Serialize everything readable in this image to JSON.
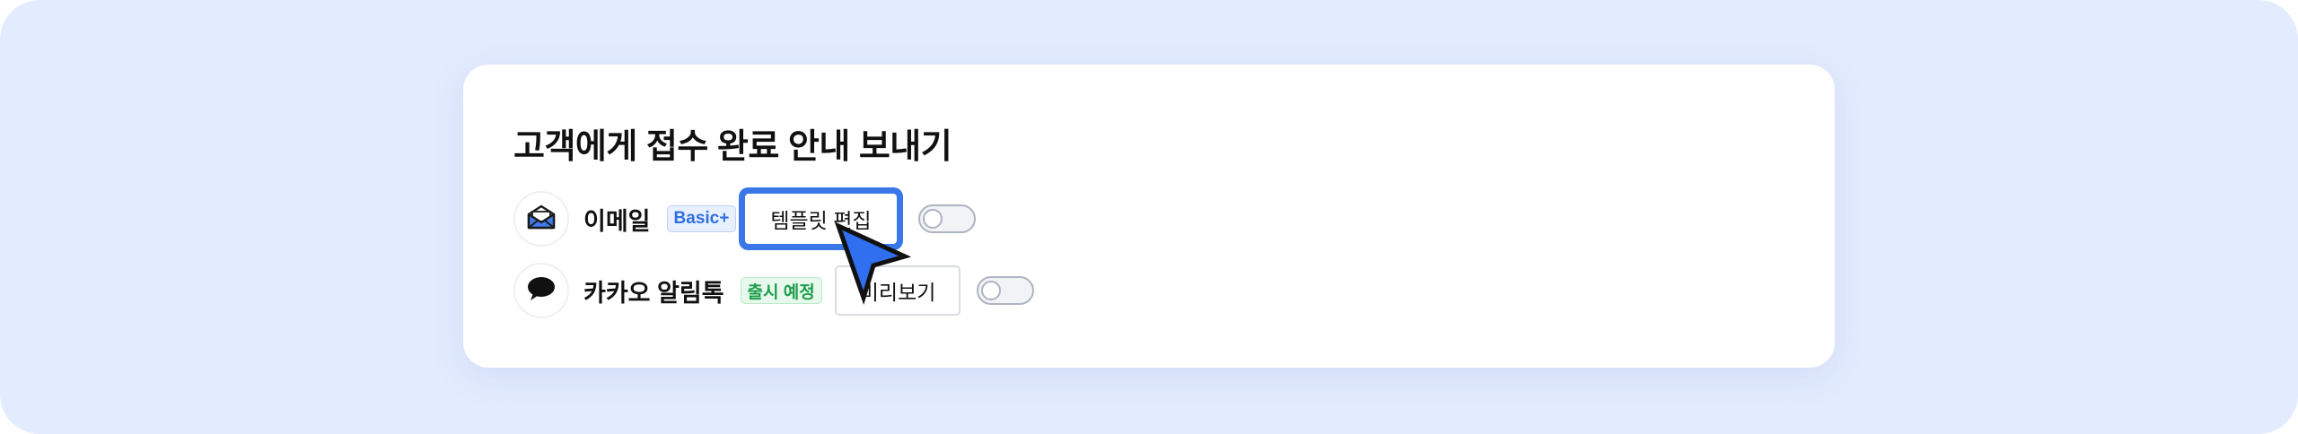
{
  "section": {
    "title": "고객에게 접수 완료 안내 보내기"
  },
  "channels": [
    {
      "icon": "envelope-icon",
      "label": "이메일",
      "badge": "Basic+",
      "action_label": "템플릿 편집",
      "toggle_on": false
    },
    {
      "icon": "speech-bubble-icon",
      "label": "카카오 알림톡",
      "badge": "출시 예정",
      "action_label": "미리보기",
      "toggle_on": false
    }
  ],
  "colors": {
    "background": "#e3ecfe",
    "focus_ring": "#3a78ea",
    "cursor_fill": "#2f6ff0",
    "badge_basic_text": "#2f6fe0",
    "badge_soon_text": "#1e9d4b"
  }
}
